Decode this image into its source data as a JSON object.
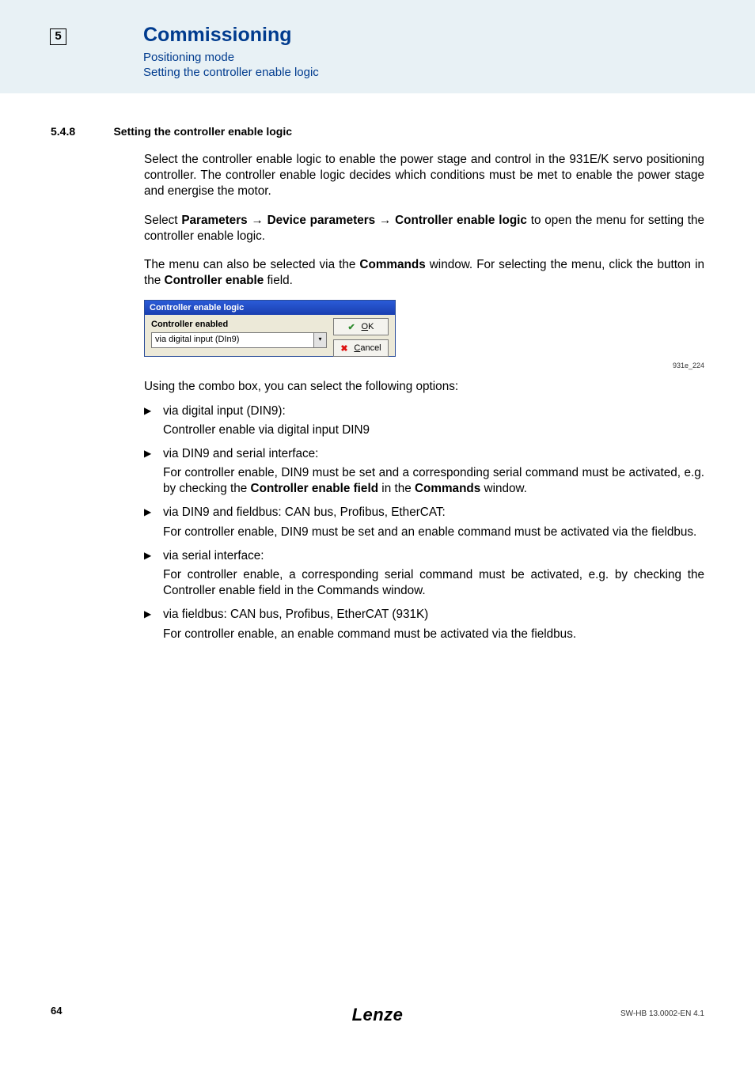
{
  "header": {
    "chapter_box": "5",
    "title": "Commissioning",
    "sub1": "Positioning mode",
    "sub2": "Setting the controller enable logic"
  },
  "section": {
    "number": "5.4.8",
    "title": "Setting the controller enable logic"
  },
  "paras": {
    "p1": "Select the controller enable logic to enable the power stage and control in the 931E/K servo positioning controller. The controller enable logic decides which conditions must be met to enable the power stage and energise the motor.",
    "p2_a": "Select ",
    "p2_b": "Parameters",
    "p2_arrow1": " → ",
    "p2_c": "Device parameters",
    "p2_arrow2": " → ",
    "p2_d": "Controller enable logic",
    "p2_e": " to open the menu for setting the controller enable logic.",
    "p3_a": "The menu can also be selected via the ",
    "p3_b": "Commands",
    "p3_c": " window. For selecting the menu, click the button in the ",
    "p3_d": "Controller enable",
    "p3_e": " field.",
    "p4": "Using the combo box, you can select the following options:"
  },
  "dialog": {
    "title": "Controller enable logic",
    "label": "Controller enabled",
    "select_value": "via digital input (DIn9)",
    "ok": "OK",
    "cancel": "Cancel"
  },
  "figref": "931e_224",
  "list": [
    {
      "head": "via digital input (DIN9):",
      "sub": "Controller enable via digital input DIN9"
    },
    {
      "head": "via DIN9 and serial interface:",
      "sub_a": "For controller enable, DIN9 must be set and a corresponding serial command must be activated, e.g. by checking the ",
      "sub_b": "Controller enable field",
      "sub_c": " in the ",
      "sub_d": "Commands",
      "sub_e": " window."
    },
    {
      "head": "via DIN9 and fieldbus: CAN bus, Profibus, EtherCAT:",
      "sub": "For controller enable, DIN9 must be set and an enable command must be activated via the fieldbus."
    },
    {
      "head": "via serial interface:",
      "sub": "For controller enable, a corresponding serial command must be activated, e.g. by checking the Controller enable field in the Commands window."
    },
    {
      "head": "via fieldbus: CAN bus, Profibus, EtherCAT (931K)",
      "sub": "For controller enable, an enable command must be activated via the fieldbus."
    }
  ],
  "footer": {
    "page": "64",
    "logo": "Lenze",
    "docid": "SW-HB 13.0002-EN   4.1"
  },
  "glyphs": {
    "tri": "▶"
  }
}
